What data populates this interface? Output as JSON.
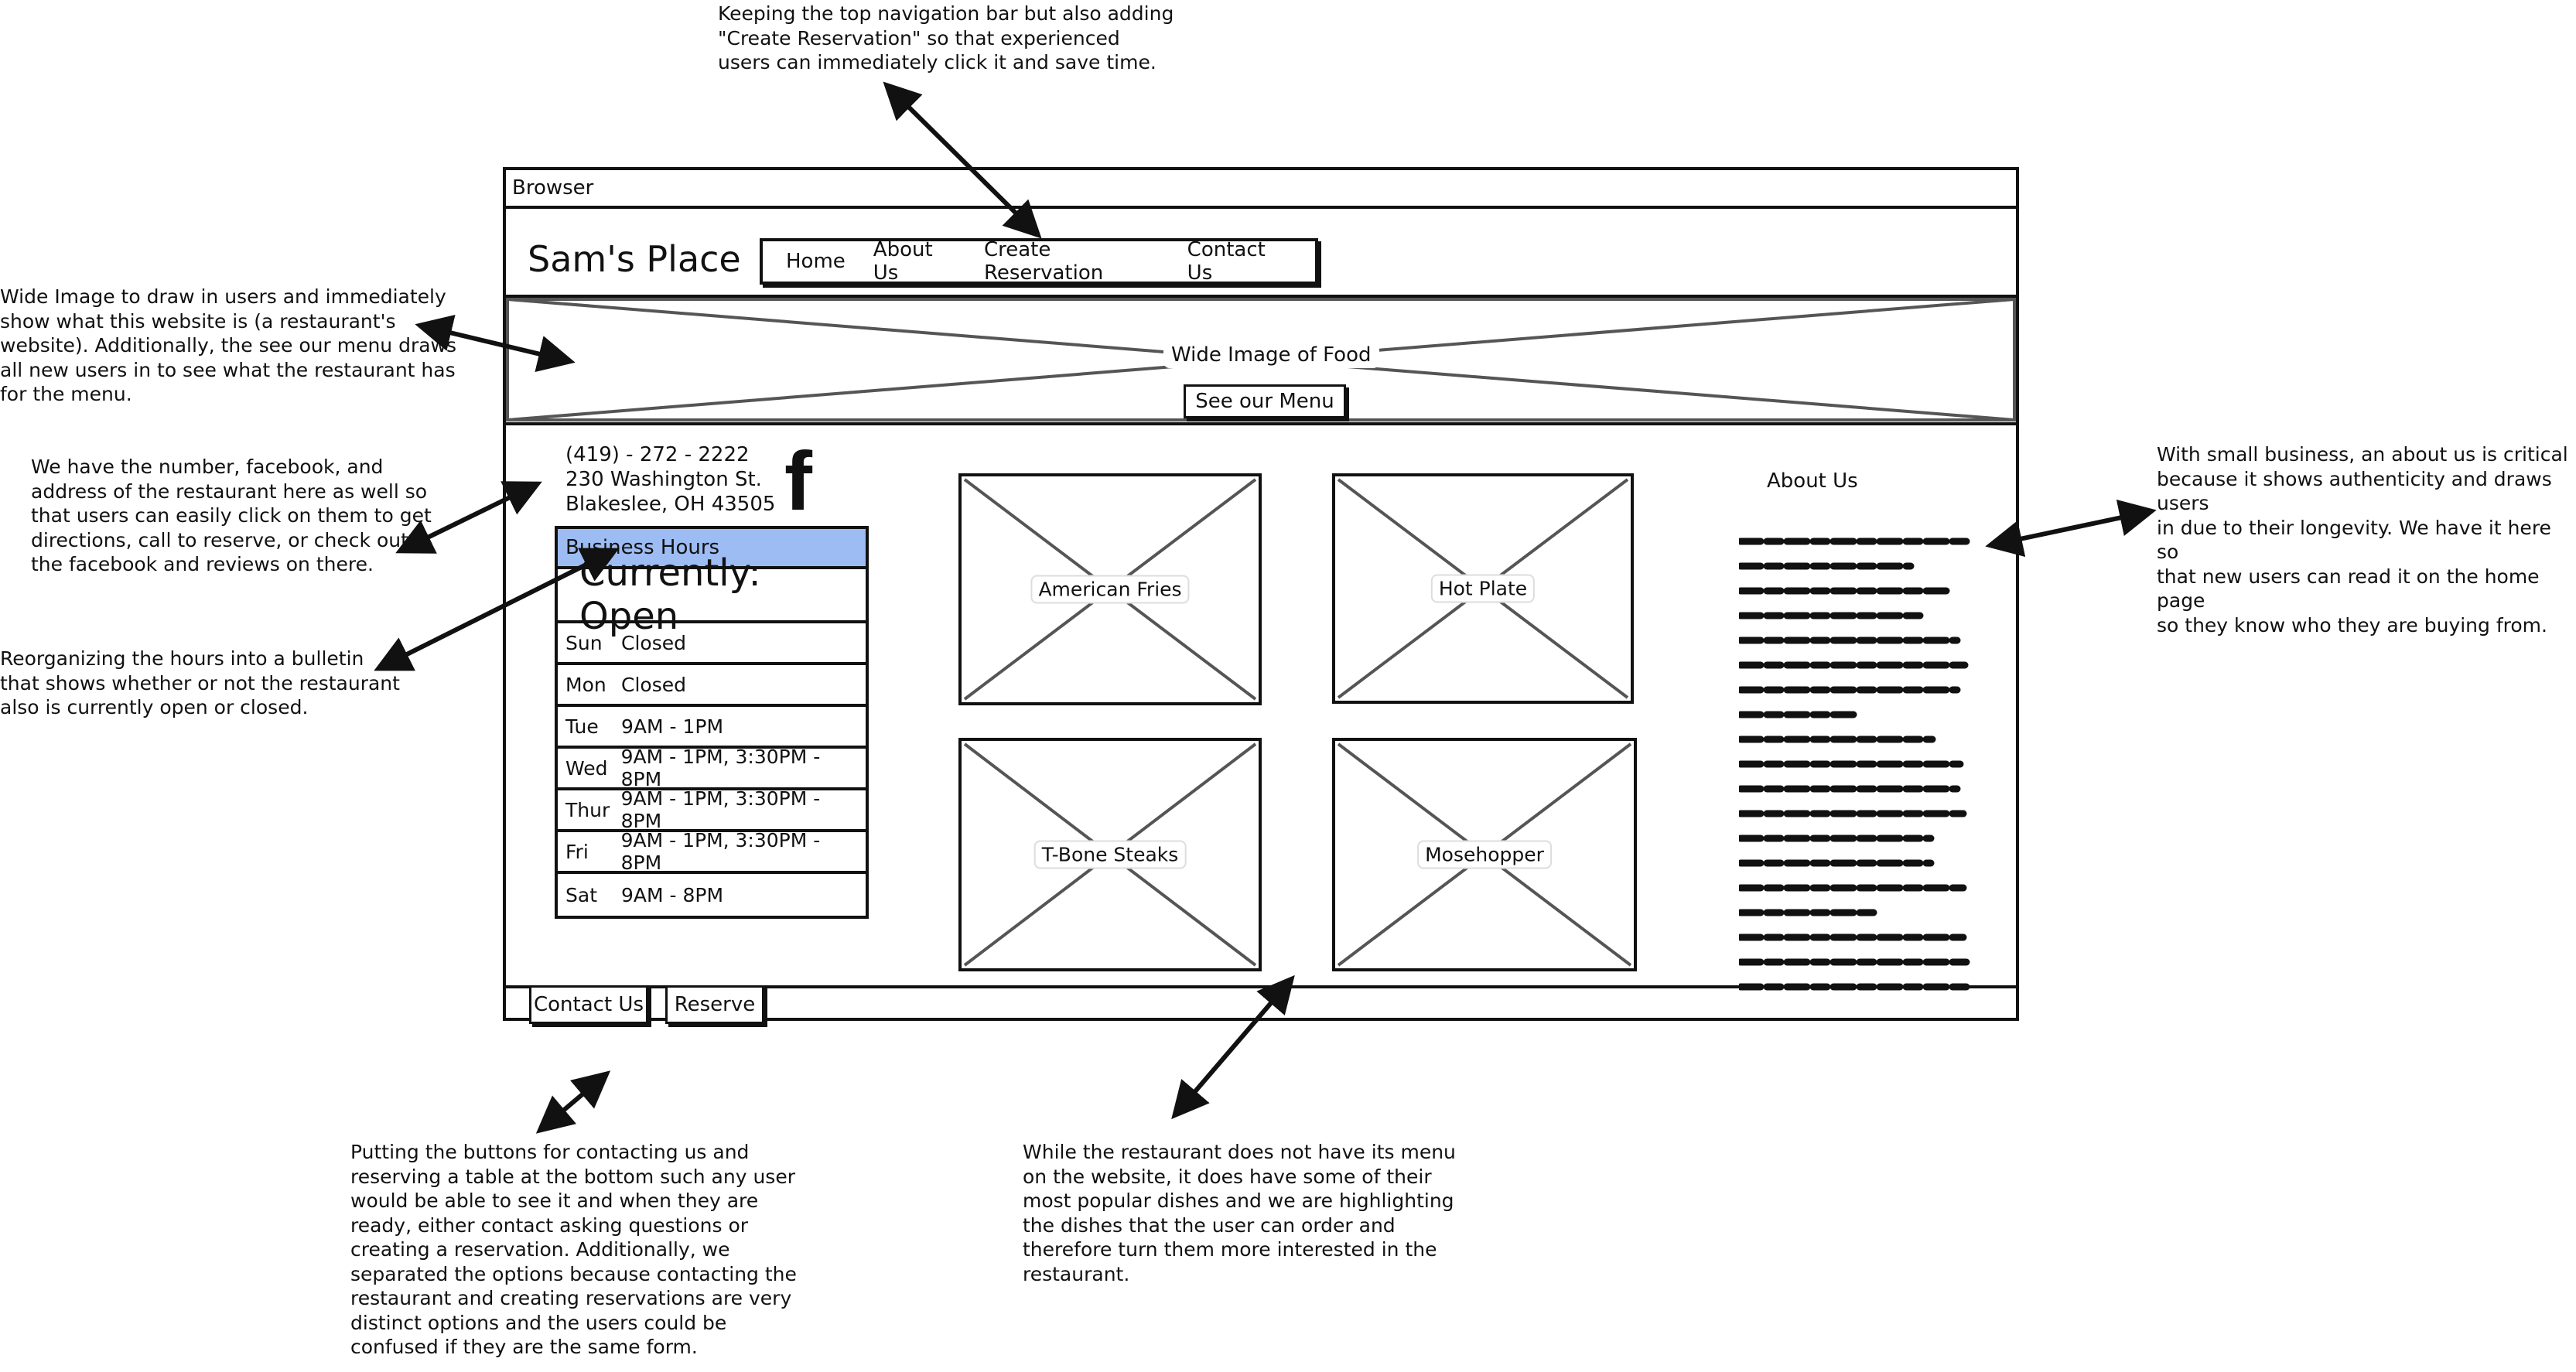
{
  "annotations": {
    "top": "Keeping the top navigation bar but also adding\n\"Create Reservation\" so that experienced\nusers can immediately click it and save time.",
    "hero": "Wide Image to draw in users and immediately\nshow what this website is (a restaurant's\nwebsite). Additionally, the see our menu draws\nall new users in to see what the restaurant has\nfor the menu.",
    "contact": "We have the number, facebook, and\naddress of the restaurant here as well so\nthat users can easily click on them to get\ndirections, call to reserve, or check out\nthe facebook and reviews on there.",
    "hours": "Reorganizing the hours into a bulletin\nthat shows whether or not the restaurant\nalso is currently open or closed.",
    "about": "With small business, an about us is critical\nbecause it shows authenticity and draws users\nin due to their longevity. We have it here so\nthat new users can read it on the home page\nso they know who they are buying from.",
    "buttons": "Putting the buttons for contacting us and\nreserving a table at the bottom such any user\nwould be able to see it and when they are\nready, either contact asking questions or\ncreating a reservation. Additionally, we\nseparated the options because contacting the\nrestaurant and creating reservations are very\ndistinct options and the users could be\nconfused if they are the same form.",
    "dishes": "While the restaurant does not have its menu\non the website, it does have some of their\nmost popular dishes and we are highlighting\nthe dishes that the user can order and\ntherefore turn them more interested in the\nrestaurant."
  },
  "browser": {
    "title": "Browser"
  },
  "site": {
    "name": "Sam's Place"
  },
  "nav": {
    "items": [
      "Home",
      "About Us",
      "Create Reservation",
      "Contact Us"
    ]
  },
  "hero": {
    "label": "Wide Image of Food",
    "button": "See our Menu"
  },
  "contact": {
    "phone": "(419) - 272 - 2222",
    "street": "230 Washington St.",
    "city": "Blakeslee, OH 43505",
    "icon": "facebook-icon"
  },
  "hours": {
    "title": "Business Hours",
    "status": "Currently: Open",
    "header_color": "#9dbcf4",
    "rows": [
      {
        "day": "Sun",
        "time": "Closed"
      },
      {
        "day": "Mon",
        "time": "Closed"
      },
      {
        "day": "Tue",
        "time": "9AM - 1PM"
      },
      {
        "day": "Wed",
        "time": "9AM - 1PM, 3:30PM - 8PM"
      },
      {
        "day": "Thur",
        "time": "9AM - 1PM, 3:30PM - 8PM"
      },
      {
        "day": "Fri",
        "time": "9AM - 1PM, 3:30PM - 8PM"
      },
      {
        "day": "Sat",
        "time": "9AM - 8PM"
      }
    ]
  },
  "dishes": [
    "American Fries",
    "Hot Plate",
    "T-Bone Steaks",
    "Mosehopper"
  ],
  "about": {
    "title": "About Us"
  },
  "footer": {
    "contact_label": "Contact Us",
    "reserve_label": "Reserve"
  }
}
